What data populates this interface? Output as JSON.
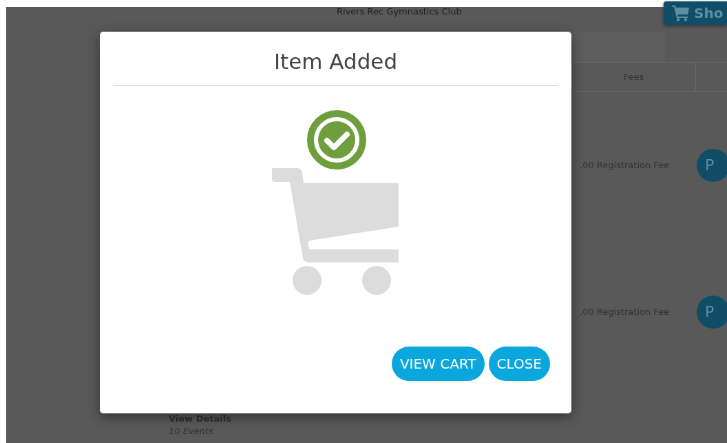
{
  "page": {
    "club_name": "Rivers Rec Gymnastics Club",
    "shop_button": "Sho",
    "table": {
      "columns": [
        "Fees"
      ],
      "rows": [
        {
          "fee": ".00 Registration Fee",
          "action": "P"
        },
        {
          "fee": ".00 Registration Fee",
          "action": "P"
        }
      ]
    },
    "view_details": "View Details",
    "events_count": "10 Events"
  },
  "dialog": {
    "title": "Item Added",
    "buttons": [
      "VIEW CART",
      "CLOSE"
    ]
  }
}
